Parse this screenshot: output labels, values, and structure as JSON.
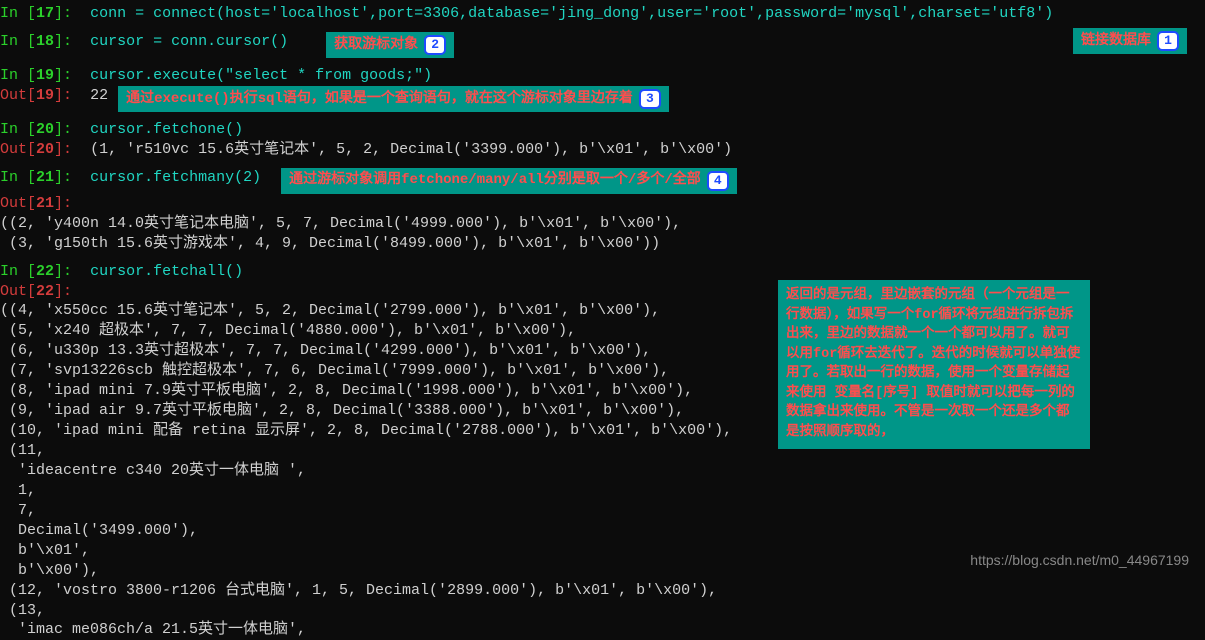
{
  "callouts": {
    "c1": {
      "label": "链接数据库",
      "num": "1"
    },
    "c2": {
      "label": "获取游标对象",
      "num": "2"
    },
    "c3": {
      "label": "通过execute()执行sql语句，如果是一个查询语句，就在这个游标对象里边存着",
      "num": "3"
    },
    "c4": {
      "label": "通过游标对象调用fetchone/many/all分别是取一个/多个/全部",
      "num": "4"
    },
    "c5": {
      "label": "返回的是元组，里边嵌套的元组（一个元组是一行数据），如果写一个for循环将元组进行拆包拆出来，里边的数据就一个一个都可以用了。就可以用for循环去迭代了。迭代的时候就可以单独使用了。若取出一行的数据，使用一个变量存储起来使用 变量名[序号] 取值时就可以把每一列的数据拿出来使用。不管是一次取一个还是多个都是按照顺序取的，"
    }
  },
  "cells": {
    "in17": "conn = connect(host='localhost',port=3306,database='jing_dong',user='root',password='mysql',charset='utf8')",
    "in18": "cursor = conn.cursor()",
    "in19": "cursor.execute(\"select * from goods;\")",
    "out19": "22",
    "in20": "cursor.fetchone()",
    "out20": "(1, 'r510vc 15.6英寸笔记本', 5, 2, Decimal('3399.000'), b'\\x01', b'\\x00')",
    "in21": "cursor.fetchmany(2)",
    "out21": [
      "((2, 'y400n 14.0英寸笔记本电脑', 5, 7, Decimal('4999.000'), b'\\x01', b'\\x00'),",
      " (3, 'g150th 15.6英寸游戏本', 4, 9, Decimal('8499.000'), b'\\x01', b'\\x00'))"
    ],
    "in22": "cursor.fetchall()",
    "out22": [
      "((4, 'x550cc 15.6英寸笔记本', 5, 2, Decimal('2799.000'), b'\\x01', b'\\x00'),",
      " (5, 'x240 超极本', 7, 7, Decimal('4880.000'), b'\\x01', b'\\x00'),",
      " (6, 'u330p 13.3英寸超极本', 7, 7, Decimal('4299.000'), b'\\x01', b'\\x00'),",
      " (7, 'svp13226scb 触控超极本', 7, 6, Decimal('7999.000'), b'\\x01', b'\\x00'),",
      " (8, 'ipad mini 7.9英寸平板电脑', 2, 8, Decimal('1998.000'), b'\\x01', b'\\x00'),",
      " (9, 'ipad air 9.7英寸平板电脑', 2, 8, Decimal('3388.000'), b'\\x01', b'\\x00'),",
      " (10, 'ipad mini 配备 retina 显示屏', 2, 8, Decimal('2788.000'), b'\\x01', b'\\x00'),",
      " (11,",
      "  'ideacentre c340 20英寸一体电脑 ',",
      "  1,",
      "  7,",
      "  Decimal('3499.000'),",
      "  b'\\x01',",
      "  b'\\x00'),",
      " (12, 'vostro 3800-r1206 台式电脑', 1, 5, Decimal('2899.000'), b'\\x01', b'\\x00'),",
      " (13,",
      "  'imac me086ch/a 21.5英寸一体电脑',"
    ]
  },
  "labels": {
    "in": "In [",
    "out": "Out[",
    "close": "]:"
  },
  "nums": {
    "n17": "17",
    "n18": "18",
    "n19": "19",
    "n20": "20",
    "n21": "21",
    "n22": "22"
  },
  "watermark": "https://blog.csdn.net/m0_44967199"
}
